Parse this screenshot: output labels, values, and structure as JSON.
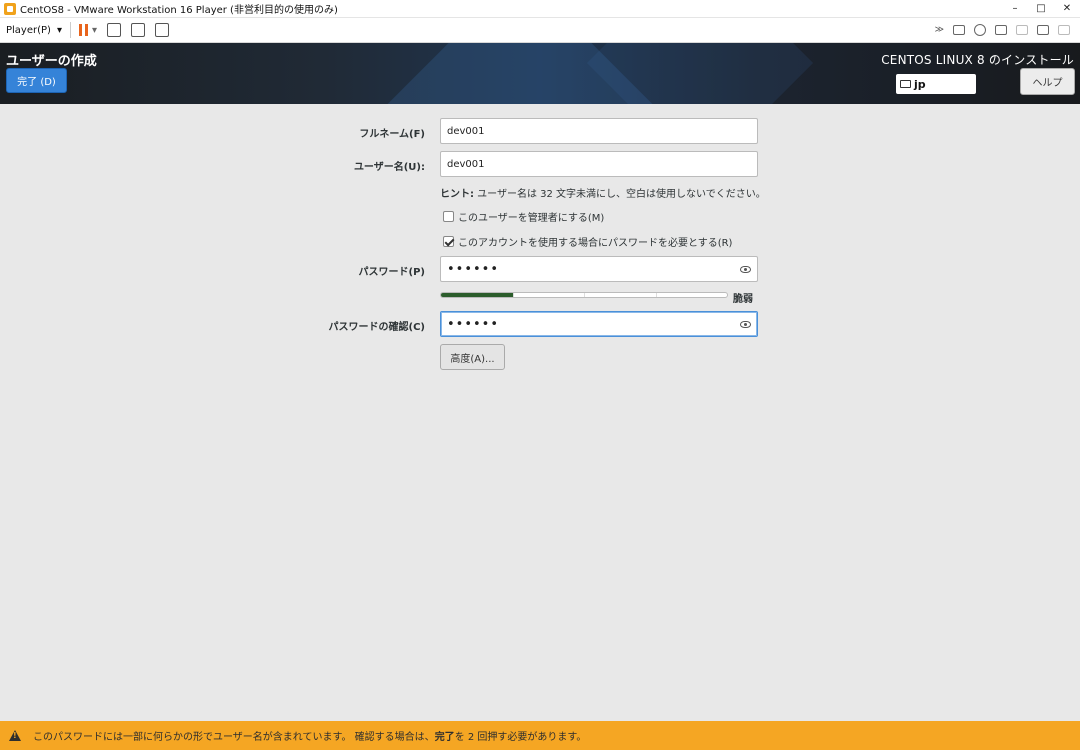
{
  "window": {
    "title": "CentOS8 - VMware Workstation 16 Player (非営利目的の使用のみ)",
    "minimize": "–",
    "maximize": "□",
    "close": "✕"
  },
  "toolbar": {
    "player_menu": "Player(P)",
    "dropdown": "▾",
    "unity": "≫"
  },
  "header": {
    "page_title": "ユーザーの作成",
    "done_label": "完了 (D)",
    "install_title": "CENTOS LINUX 8 のインストール",
    "keyboard_layout": "jp",
    "help_label": "ヘルプ"
  },
  "form": {
    "fullname_label": "フルネーム(F)",
    "fullname_value": "dev001",
    "username_label": "ユーザー名(U):",
    "username_value": "dev001",
    "hint_prefix": "ヒント:",
    "hint_text": " ユーザー名は 32 文字未満にし、空白は使用しないでください。",
    "admin_checkbox_label": "このユーザーを管理者にする(M)",
    "admin_checked": false,
    "require_password_label": "このアカウントを使用する場合にパスワードを必要とする(R)",
    "require_password_checked": true,
    "password_label": "パスワード(P)",
    "password_value": "••••••",
    "strength_fraction": 0.25,
    "strength_label": "脆弱",
    "confirm_label": "パスワードの確認(C)",
    "confirm_value": "••••••",
    "advanced_label": "高度(A)..."
  },
  "warning": {
    "text_before": "このパスワードには一部に何らかの形でユーザー名が含まれています。 確認する場合は、",
    "emphasis": "完了",
    "text_after": " を 2 回押す必要があります。"
  },
  "colors": {
    "accent": "#3583d8",
    "warning": "#f5a623",
    "strength_fill": "#2c5d2c"
  }
}
